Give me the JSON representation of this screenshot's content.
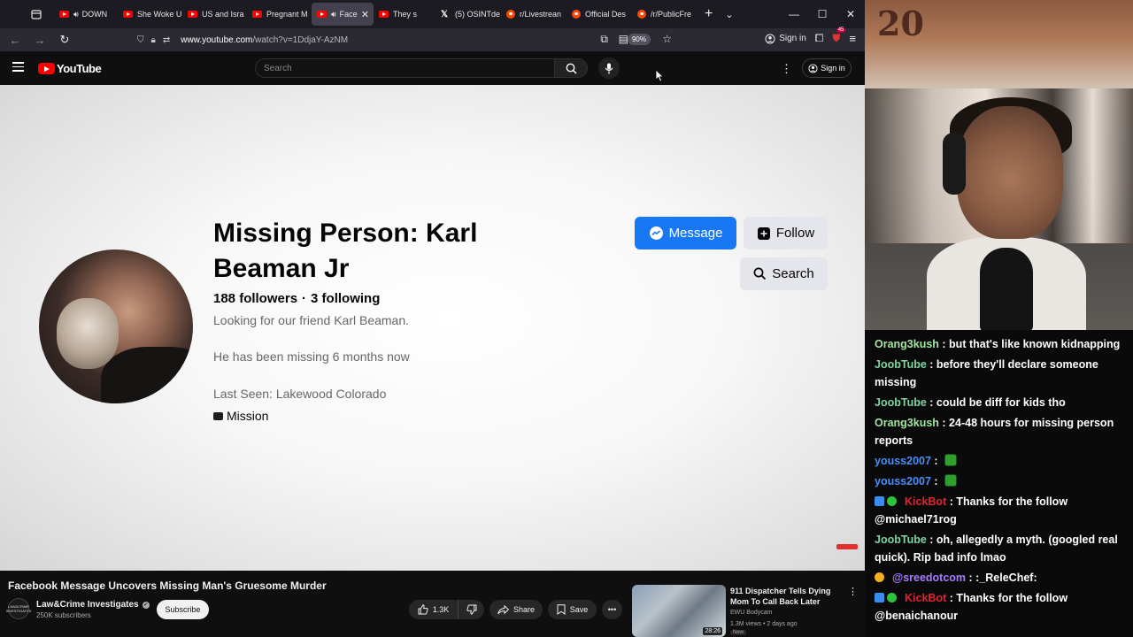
{
  "browser": {
    "tabs": [
      {
        "label": "DOWN",
        "icon": "youtube-icon",
        "audio": true,
        "active": false
      },
      {
        "label": "She Woke U",
        "icon": "youtube-icon",
        "audio": false,
        "active": false
      },
      {
        "label": "US and Isra",
        "icon": "youtube-icon",
        "audio": false,
        "active": false
      },
      {
        "label": "Pregnant M",
        "icon": "youtube-icon",
        "audio": false,
        "active": false
      },
      {
        "label": "Face",
        "icon": "youtube-icon",
        "audio": true,
        "active": true
      },
      {
        "label": "They s",
        "icon": "youtube-icon",
        "audio": false,
        "active": false
      },
      {
        "label": "(5) OSINTde",
        "icon": "x-icon",
        "audio": false,
        "active": false
      },
      {
        "label": "r/Livestrean",
        "icon": "reddit-icon",
        "audio": false,
        "active": false
      },
      {
        "label": "Official Des",
        "icon": "reddit-icon",
        "audio": false,
        "active": false
      },
      {
        "label": "/r/PublicFre",
        "icon": "reddit-icon",
        "audio": false,
        "active": false
      }
    ],
    "url_host": "www.youtube.com",
    "url_path": "/watch?v=1DdjaY-AzNM",
    "zoom": "90%",
    "signin_label": "Sign in",
    "extension_badge": "45"
  },
  "youtube": {
    "logo_text": "YouTube",
    "search_placeholder": "Search",
    "signin_label": "Sign in"
  },
  "video_frame": {
    "profile_name": "Missing Person: Karl Beaman Jr",
    "followers": "188 followers",
    "following": "3 following",
    "bio_line1": "Looking for our friend Karl Beaman.",
    "bio_line2": "He has been missing 6 months now",
    "bio_line3": "Last Seen: Lakewood Colorado",
    "work": "Mission",
    "message_label": "Message",
    "follow_label": "Follow",
    "search_label": "Search"
  },
  "video": {
    "title": "Facebook Message Uncovers Missing Man's Gruesome Murder",
    "channel": "Law&Crime Investigates",
    "channel_avatar_text": "LAW&CRIME INVESTIGATES",
    "subscribers": "250K subscribers",
    "subscribe_label": "Subscribe",
    "likes": "1.3K",
    "share_label": "Share",
    "save_label": "Save"
  },
  "recommended": {
    "title": "911 Dispatcher Tells Dying Mom To Call Back Later",
    "channel": "EWU Bodycam",
    "meta": "1.3M views • 2 days ago",
    "badge": "New",
    "duration": "28:26"
  },
  "stream": {
    "seal_text": "20"
  },
  "chat": [
    {
      "user": "Orang3kush",
      "color": "#a3e4a1",
      "badges": [],
      "text": "but that's like known kidnapping"
    },
    {
      "user": "JoobTube",
      "color": "#7ed3a0",
      "badges": [],
      "text": "before they'll declare someone missing"
    },
    {
      "user": "JoobTube",
      "color": "#7ed3a0",
      "badges": [],
      "text": "could be diff for kids tho"
    },
    {
      "user": "Orang3kush",
      "color": "#a3e4a1",
      "badges": [],
      "text": "24-48 hours for missing person reports"
    },
    {
      "user": "youss2007",
      "color": "#4b8df7",
      "badges": [],
      "text": "",
      "emote": true
    },
    {
      "user": "youss2007",
      "color": "#4b8df7",
      "badges": [],
      "text": "",
      "emote": true
    },
    {
      "user": "KickBot",
      "color": "#e0232f",
      "badges": [
        "bot",
        "verified"
      ],
      "text": "Thanks for the follow @michael71rog"
    },
    {
      "user": "JoobTube",
      "color": "#7ed3a0",
      "badges": [],
      "text": "oh, allegedly a myth. (googled real quick). Rip bad info lmao"
    },
    {
      "user": "@sreedotcom",
      "color": "#a77bff",
      "badges": [
        "sub"
      ],
      "text": ":_ReleChef:"
    },
    {
      "user": "KickBot",
      "color": "#e0232f",
      "badges": [
        "bot",
        "verified"
      ],
      "text": "Thanks for the follow @benaichanour"
    }
  ]
}
